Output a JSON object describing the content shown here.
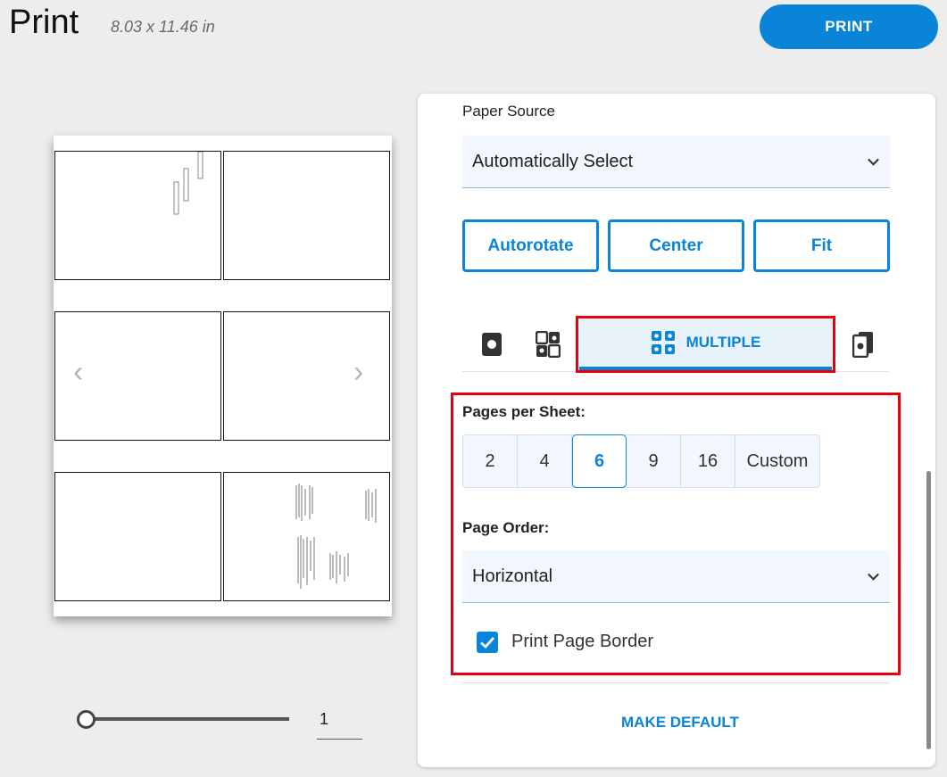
{
  "header": {
    "title": "Print",
    "page_size": "8.03 x 11.46 in",
    "print_label": "PRINT"
  },
  "preview": {
    "current_page": "1"
  },
  "panel": {
    "paper_source_label": "Paper Source",
    "paper_source_value": "Automatically Select",
    "buttons": {
      "autorotate": "Autorotate",
      "center": "Center",
      "fit": "Fit"
    },
    "tabs": {
      "multiple_label": "MULTIPLE"
    },
    "pages_per_sheet_label": "Pages per Sheet:",
    "pages_per_sheet_options": [
      "2",
      "4",
      "6",
      "9",
      "16",
      "Custom"
    ],
    "pages_per_sheet_selected": "6",
    "page_order_label": "Page Order:",
    "page_order_value": "Horizontal",
    "print_page_border_label": "Print Page Border",
    "print_page_border_checked": true,
    "make_default_label": "MAKE DEFAULT"
  },
  "colors": {
    "accent": "#0a84d8",
    "highlight": "#e8000c"
  }
}
